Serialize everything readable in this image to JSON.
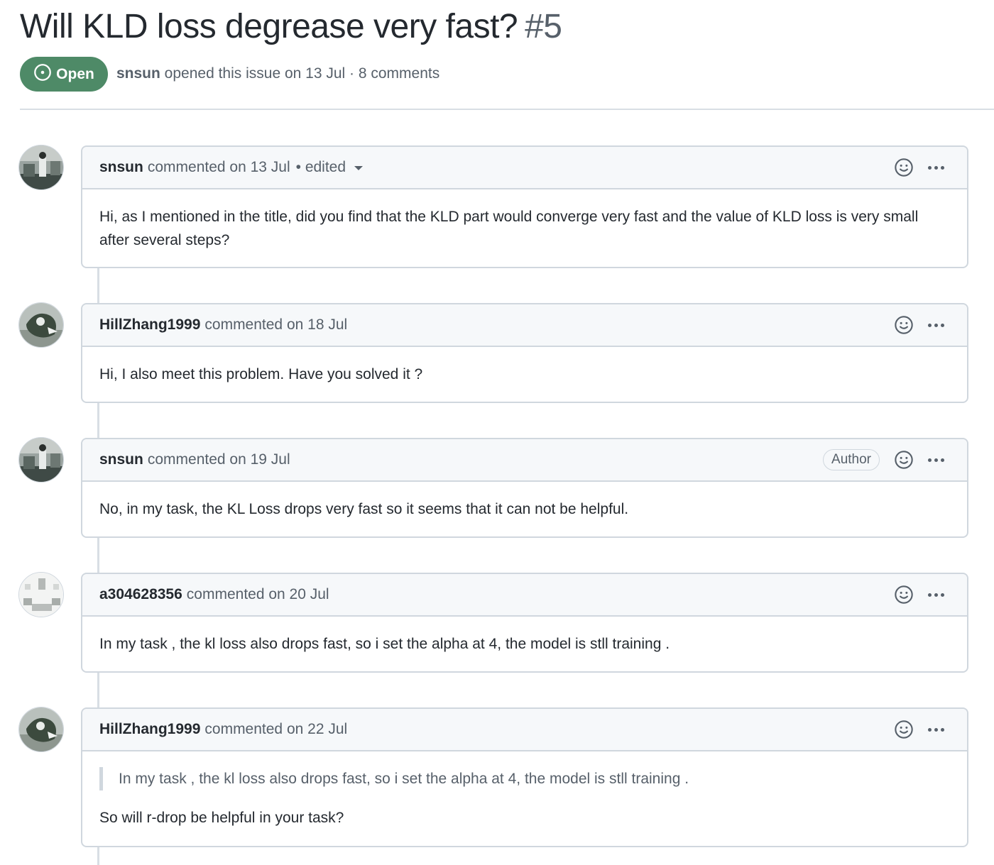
{
  "issue": {
    "title": "Will KLD loss degrease very fast?",
    "number": "#5",
    "state": "Open",
    "author": "snsun",
    "meta": " opened this issue on 13 Jul · 8 comments"
  },
  "comments": [
    {
      "author": "snsun",
      "meta": "commented on 13 Jul",
      "edited": "• edited",
      "body": "Hi, as I mentioned in the title, did you find that the KLD part would converge very fast and the value of KLD loss is very small after several steps?",
      "avatar": "avatar-snsun"
    },
    {
      "author": "HillZhang1999",
      "meta": "commented on 18 Jul",
      "body": "Hi, I also meet this problem. Have you solved it ?",
      "avatar": "avatar-hillzhang"
    },
    {
      "author": "snsun",
      "meta": "commented on 19 Jul",
      "badge": "Author",
      "body": "No, in my task, the KL Loss drops very fast so it seems that it can not be helpful.",
      "avatar": "avatar-snsun"
    },
    {
      "author": "a304628356",
      "meta": "commented on 20 Jul",
      "body": "In my task , the kl loss also drops fast, so i set the alpha at 4, the model is stll training .",
      "avatar": "avatar-identicon"
    },
    {
      "author": "HillZhang1999",
      "meta": "commented on 22 Jul",
      "quote": "In my task , the kl loss also drops fast, so i set the alpha at 4, the model is stll training .",
      "body": "So will r-drop be helpful in your task?",
      "avatar": "avatar-hillzhang"
    }
  ],
  "icons": {
    "state": "issue-opened-icon",
    "reaction": "smiley-icon",
    "menu": "kebab-horizontal-icon",
    "caret": "triangle-down-icon"
  },
  "colors": {
    "open_green": "#4e8a67",
    "border": "#d0d7de",
    "header_bg": "#f6f8fa",
    "muted_text": "#57606a",
    "text": "#24292f"
  }
}
